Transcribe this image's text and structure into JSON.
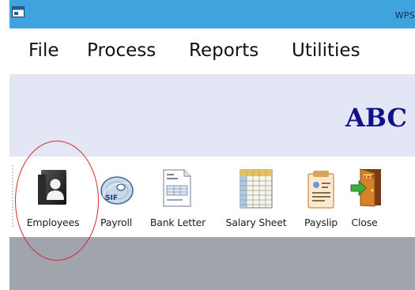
{
  "window": {
    "title": "WPS"
  },
  "menu": {
    "items": [
      {
        "label": "File"
      },
      {
        "label": "Process"
      },
      {
        "label": "Reports"
      },
      {
        "label": "Utilities"
      }
    ]
  },
  "banner": {
    "company": "ABC"
  },
  "toolbar": {
    "buttons": [
      {
        "label": "Employees",
        "icon": "employee-folder-icon"
      },
      {
        "label": "Payroll",
        "icon": "sif-disc-icon"
      },
      {
        "label": "Bank Letter",
        "icon": "document-icon"
      },
      {
        "label": "Salary Sheet",
        "icon": "spreadsheet-icon"
      },
      {
        "label": "Payslip",
        "icon": "payslip-icon"
      },
      {
        "label": "Close",
        "icon": "exit-door-icon"
      }
    ]
  },
  "colors": {
    "titlebar": "#3fa3de",
    "banner_bg": "#e3e7f5",
    "company_text": "#11118a",
    "highlight": "#d62b2b",
    "workspace": "#a0a4ad"
  }
}
